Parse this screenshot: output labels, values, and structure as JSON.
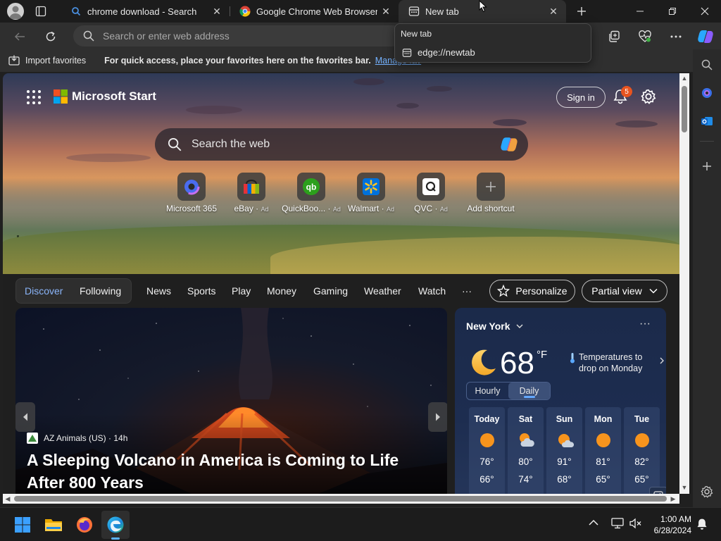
{
  "tabs": [
    {
      "title": "chrome download - Search",
      "icon": "bing-search-icon"
    },
    {
      "title": "Google Chrome Web Browser",
      "icon": "chrome-logo-icon"
    },
    {
      "title": "New tab",
      "icon": "newtab-icon",
      "active": true
    }
  ],
  "hovercard": {
    "title": "New tab",
    "url": "edge://newtab"
  },
  "address": {
    "placeholder": "Search or enter web address"
  },
  "favorites": {
    "import_label": "Import favorites",
    "message": "For quick access, place your favorites here on the favorites bar.",
    "manage_link": "Manage fav"
  },
  "start": {
    "brand": "Microsoft Start",
    "signin": "Sign in",
    "notification_count": "5",
    "search_placeholder": "Search the web"
  },
  "shortcuts": [
    {
      "label": "Microsoft 365",
      "ad": ""
    },
    {
      "label": "eBay",
      "ad": "Ad"
    },
    {
      "label": "QuickBoo...",
      "ad": "Ad"
    },
    {
      "label": "Walmart",
      "ad": "Ad"
    },
    {
      "label": "QVC",
      "ad": "Ad"
    },
    {
      "label": "Add shortcut",
      "ad": ""
    }
  ],
  "feednav": {
    "items": [
      "Discover",
      "Following",
      "News",
      "Sports",
      "Play",
      "Money",
      "Gaming",
      "Weather",
      "Watch",
      "···"
    ],
    "active": "Discover",
    "personalize": "Personalize",
    "partial_view": "Partial view"
  },
  "story": {
    "source": "AZ Animals (US) · 14h",
    "title": "A Sleeping Volcano in America is Coming to Life After 800 Years"
  },
  "weather": {
    "city": "New York",
    "temp": "68",
    "unit": "°F",
    "alert": "Temperatures to drop on Monday",
    "tabs": [
      "Hourly",
      "Daily"
    ],
    "active_tab": "Daily",
    "days": [
      {
        "name": "Today",
        "hi": "76°",
        "lo": "66°",
        "icon": "sun-icon"
      },
      {
        "name": "Sat",
        "hi": "80°",
        "lo": "74°",
        "icon": "partly-cloudy-icon"
      },
      {
        "name": "Sun",
        "hi": "91°",
        "lo": "68°",
        "icon": "partly-cloudy-icon"
      },
      {
        "name": "Mon",
        "hi": "81°",
        "lo": "65°",
        "icon": "sun-icon"
      },
      {
        "name": "Tue",
        "hi": "82°",
        "lo": "65°",
        "icon": "sun-icon"
      }
    ]
  },
  "clock": {
    "time": "1:00 AM",
    "date": "6/28/2024"
  },
  "colors": {
    "accent": "#8ab4f8",
    "link": "#74b2ff",
    "badge": "#e8541f"
  }
}
